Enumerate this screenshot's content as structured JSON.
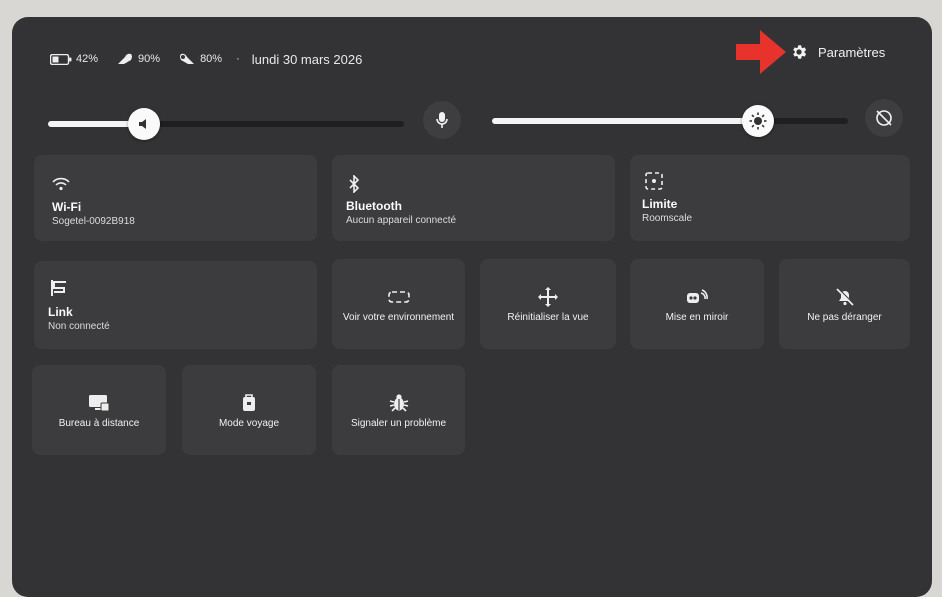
{
  "status": {
    "battery_headset": "42%",
    "battery_controller_right": "90%",
    "battery_controller_left": "80%",
    "separator": "·",
    "date": "lundi 30 mars 2026"
  },
  "settings_label": "Paramètres",
  "annotation_arrow_color": "#e8322c",
  "volume_level": 0.27,
  "brightness_level": 0.74,
  "tiles": {
    "wifi": {
      "title": "Wi-Fi",
      "subtitle": "Sogetel-0092B918"
    },
    "bluetooth": {
      "title": "Bluetooth",
      "subtitle": "Aucun appareil connecté"
    },
    "boundary": {
      "title": "Limite",
      "subtitle": "Roomscale"
    },
    "link": {
      "title": "Link",
      "subtitle": "Non connecté"
    },
    "passthrough": {
      "label": "Voir votre environnement"
    },
    "recenter": {
      "label": "Réinitialiser la vue"
    },
    "cast": {
      "label": "Mise en miroir"
    },
    "dnd": {
      "label": "Ne pas déranger"
    },
    "remote_desktop": {
      "label": "Bureau à distance"
    },
    "travel_mode": {
      "label": "Mode voyage"
    },
    "report_bug": {
      "label": "Signaler un problème"
    }
  },
  "icons": [
    "battery-icon",
    "controller-right-icon",
    "controller-left-icon",
    "gear-icon",
    "speaker-icon",
    "microphone-icon",
    "brightness-icon",
    "eye-comfort-icon",
    "wifi-icon",
    "bluetooth-icon",
    "boundary-icon",
    "link-icon",
    "passthrough-icon",
    "recenter-icon",
    "cast-icon",
    "bell-off-icon",
    "remote-desktop-icon",
    "suitcase-icon",
    "bug-icon"
  ]
}
